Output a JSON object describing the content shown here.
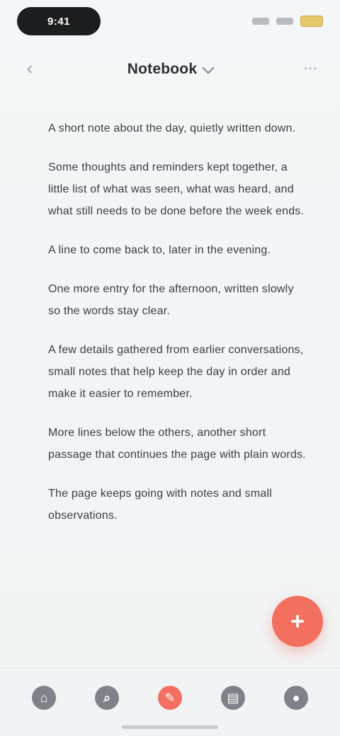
{
  "status_bar": {
    "time": "9:41"
  },
  "header": {
    "title": "Notebook"
  },
  "content": {
    "paragraphs": [
      "A short note about the day, quietly written down.",
      "Some thoughts and reminders kept together, a little list of what was seen, what was heard, and what still needs to be done before the week ends.",
      "A line to come back to, later in the evening.",
      "One more entry for the afternoon, written slowly so the words stay clear.",
      "A few details gathered from earlier conversations, small notes that help keep the day in order and make it easier to remember.",
      "More lines below the others, another short passage that continues the page with plain words.",
      "The page keeps going with notes and small observations."
    ]
  },
  "fab": {
    "label": "+"
  },
  "bottom_nav": {
    "items": [
      {
        "name": "nav-home",
        "icon": "home-icon"
      },
      {
        "name": "nav-search",
        "icon": "search-icon"
      },
      {
        "name": "nav-compose",
        "icon": "compose-icon"
      },
      {
        "name": "nav-library",
        "icon": "library-icon"
      },
      {
        "name": "nav-profile",
        "icon": "profile-icon"
      }
    ]
  },
  "colors": {
    "accent": "#f36f5f",
    "text": "#3a4046",
    "background": "#f2f4f5"
  }
}
